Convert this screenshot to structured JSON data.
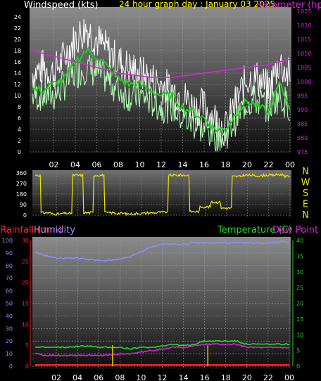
{
  "header": {
    "windspeed_label": "Windspeed (kts)",
    "title": "24 hour graph day : January 03 2025",
    "barometer_label": "Barometer (hpa)"
  },
  "lower_header": {
    "rainfall_label": "Rainfall (mm)",
    "humidity_label": "Humidity",
    "temperature_label": "Temperature (C)",
    "dewpoint_label": "Dew Point (C)"
  },
  "colors": {
    "background": "#000000",
    "wind_gust": "#ffffff",
    "wind_speed": "#b8ffb8",
    "wind_avg": "#22cc22",
    "barometer": "#dd22dd",
    "direction": "#e8e800",
    "humidity": "#8f8fff",
    "temperature": "#22dd22",
    "dewpoint": "#dd22dd",
    "rainfall": "#ff2222",
    "rain_rate": "#d8c800",
    "title": "#ffff00",
    "axis_text": "#ffffff"
  },
  "chart_data": [
    {
      "type": "line",
      "name": "wind-barometer",
      "title": "24 hour graph day : January 03 2025",
      "ylabel": "Windspeed (kts)",
      "y2label": "Barometer (hpa)",
      "ylim": [
        0,
        25
      ],
      "y2lim": [
        975,
        1025
      ],
      "x_ticks": [
        "02",
        "04",
        "06",
        "08",
        "10",
        "12",
        "14",
        "16",
        "18",
        "20",
        "22",
        "00"
      ],
      "y_ticks": [
        0,
        2,
        4,
        6,
        8,
        10,
        12,
        14,
        16,
        18,
        20,
        22,
        24
      ],
      "y2_ticks": [
        975,
        980,
        985,
        990,
        995,
        1000,
        1005,
        1010,
        1015,
        1020,
        1025
      ],
      "x_hours": [
        0,
        1,
        2,
        3,
        4,
        5,
        6,
        7,
        8,
        9,
        10,
        11,
        12,
        13,
        14,
        15,
        16,
        17,
        18,
        19,
        20,
        21,
        22,
        23,
        24
      ],
      "series": [
        {
          "role": "gust",
          "values": [
            14,
            15,
            14,
            17,
            20,
            22,
            20,
            18,
            16,
            15,
            14,
            13,
            12,
            11,
            10,
            8,
            8,
            6,
            4,
            9,
            13,
            13,
            11,
            16,
            13
          ]
        },
        {
          "role": "speed",
          "values": [
            10,
            10,
            10,
            12,
            14,
            15,
            14,
            13,
            11,
            10,
            10,
            9,
            8,
            8,
            6,
            5,
            4,
            3,
            3,
            6,
            9,
            9,
            8,
            10,
            8
          ]
        },
        {
          "role": "average",
          "values": [
            11,
            11,
            12,
            13,
            16,
            18,
            17,
            15,
            13,
            12,
            12,
            11,
            10,
            10,
            8,
            7,
            6,
            4,
            4,
            7,
            9,
            8,
            7,
            12,
            8
          ]
        },
        {
          "role": "barometer",
          "values": [
            1011,
            1010,
            1009,
            1008,
            1007,
            1006,
            1005,
            1004,
            1003,
            1002.5,
            1002,
            1001.5,
            1001.5,
            1001.5,
            1002,
            1002.5,
            1003,
            1003.5,
            1004,
            1004.5,
            1005,
            1005.5,
            1006,
            1007,
            1008
          ]
        }
      ]
    },
    {
      "type": "line",
      "name": "wind-direction",
      "ylim": [
        0,
        360
      ],
      "y_ticks": [
        0,
        90,
        180,
        270,
        360
      ],
      "compass_labels": [
        "N",
        "W",
        "S",
        "E",
        "N"
      ],
      "x_hours": [
        0,
        1,
        2,
        3,
        4,
        5,
        6,
        7,
        8,
        9,
        10,
        11,
        12,
        13,
        14,
        15,
        16,
        17,
        18,
        19,
        20,
        21,
        22,
        23,
        24
      ],
      "series": [
        {
          "role": "direction",
          "values": [
            340,
            20,
            10,
            15,
            340,
            20,
            340,
            20,
            15,
            10,
            15,
            20,
            25,
            340,
            340,
            30,
            70,
            110,
            60,
            330,
            340,
            335,
            340,
            345,
            330
          ]
        }
      ]
    },
    {
      "type": "line",
      "name": "temp-humidity-rain",
      "ylabel": "Humidity",
      "y1label": "Rainfall (mm)",
      "y2label": "Temperature (C)",
      "ylim": [
        0,
        100
      ],
      "rain_lim": [
        0,
        30
      ],
      "temp_lim": [
        0,
        40
      ],
      "x_ticks": [
        "02",
        "04",
        "06",
        "08",
        "10",
        "12",
        "14",
        "16",
        "18",
        "20",
        "22",
        "00"
      ],
      "humidity_ticks": [
        0,
        10,
        20,
        30,
        40,
        50,
        60,
        70,
        80,
        90,
        100
      ],
      "rain_ticks": [
        0,
        5,
        10,
        15,
        20,
        25,
        30
      ],
      "temp_ticks": [
        0,
        5,
        10,
        15,
        20,
        25,
        30,
        35,
        40
      ],
      "x_hours": [
        0,
        1,
        2,
        3,
        4,
        5,
        6,
        7,
        8,
        9,
        10,
        11,
        12,
        13,
        14,
        15,
        16,
        17,
        18,
        19,
        20,
        21,
        22,
        23,
        24
      ],
      "series": [
        {
          "role": "humidity",
          "values": [
            90,
            88,
            86,
            86,
            86,
            85,
            84,
            84,
            85,
            87,
            91,
            95,
            97,
            97,
            97,
            98,
            98,
            98,
            98,
            98,
            98,
            98,
            98,
            99,
            99
          ]
        },
        {
          "role": "temperature",
          "values": [
            6,
            6,
            6,
            6,
            6.3,
            6.5,
            6,
            6,
            6,
            5.5,
            6,
            6,
            6.5,
            7,
            6.5,
            7,
            8,
            8,
            8,
            8,
            7,
            7,
            7,
            7,
            7
          ]
        },
        {
          "role": "dewpoint",
          "values": [
            4,
            3.5,
            3.5,
            3.5,
            3.5,
            3.5,
            3.5,
            3.5,
            3.8,
            4,
            4.5,
            5,
            5.5,
            6,
            6,
            6.5,
            7,
            7,
            7,
            7,
            6,
            6,
            6,
            6,
            6
          ]
        },
        {
          "role": "rainfall",
          "values": [
            0.3,
            0.3,
            0.3,
            0.3,
            0.3,
            0.3,
            0.3,
            0.3,
            0.3,
            0.3,
            0.3,
            0.3,
            0.3,
            0.3,
            0.3,
            0.3,
            0.3,
            0.3,
            0.3,
            0.3,
            0.3,
            0.3,
            0.3,
            0.3,
            0.3
          ]
        },
        {
          "role": "rain-rate",
          "points": [
            [
              7.3,
              5
            ],
            [
              16.3,
              5
            ]
          ]
        }
      ]
    }
  ]
}
